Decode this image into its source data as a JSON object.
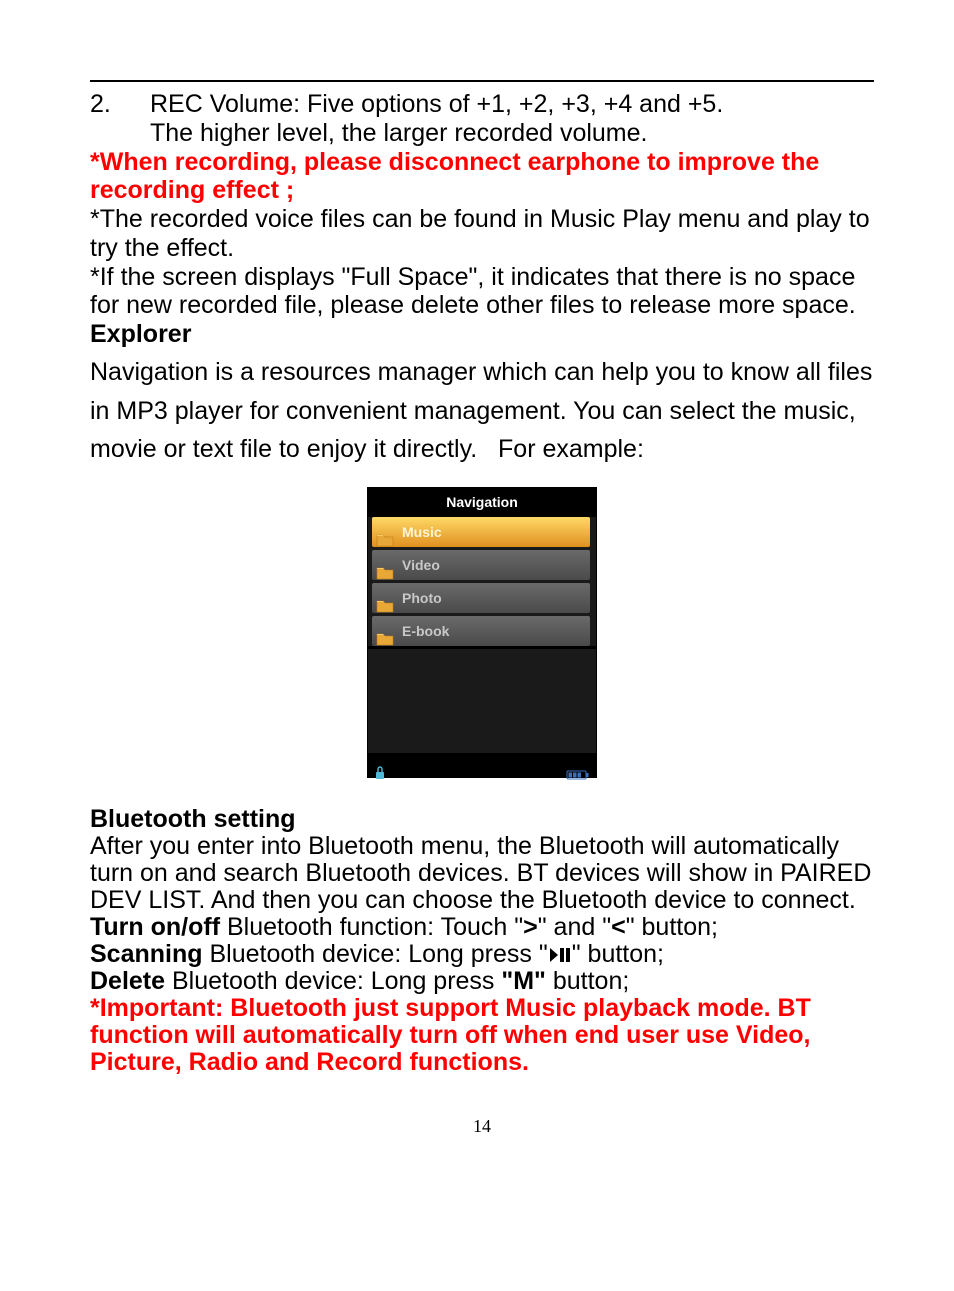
{
  "list": {
    "num": "2.",
    "line1": "REC Volume: Five options of +1, +2, +3, +4 and +5.",
    "line2": "The higher level, the larger recorded volume."
  },
  "warning1": "*When recording, please disconnect earphone to improve the recording effect ;",
  "note1": "*The recorded voice files can be found in Music Play menu and play to try the effect.",
  "note2": "*If the screen displays \"Full Space\", it indicates that there is no space for new recorded file, please delete other files to release more space.",
  "explorerHeading": "Explorer",
  "explorerPara": "Navigation is a resources manager which can help you to know all files in MP3 player for convenient management. You can select the music, movie or text file to enjoy it directly.   For example:",
  "nav": {
    "title": "Navigation",
    "items": [
      {
        "label": "Music",
        "selected": true
      },
      {
        "label": "Video",
        "selected": false
      },
      {
        "label": "Photo",
        "selected": false
      },
      {
        "label": "E-book",
        "selected": false
      }
    ]
  },
  "btHeading": "Bluetooth setting",
  "btIntro": "After you enter into Bluetooth menu, the Bluetooth will automatically turn on and search Bluetooth devices. BT devices will show in PAIRED DEV LIST. And then you can choose the Bluetooth device to connect.",
  "bt": {
    "turnLabel": "Turn on/off",
    "turnText1": " Bluetooth function: Touch \"",
    "gt": ">",
    "turnText2": "\" and \"",
    "lt": "<",
    "turnText3": "\" button;",
    "scanLabel": "Scanning",
    "scanText1": " Bluetooth device: Long press \"",
    "playPause": "▶❙❙",
    "scanText2": "\" button;",
    "deleteLabel": "Delete",
    "deleteText1": " Bluetooth device: Long press ",
    "mBtn": "\"M\"",
    "deleteText2": " button;"
  },
  "btWarning": "*Important: Bluetooth just support Music playback mode. BT function will automatically turn off when end user use Video, Picture, Radio and Record functions.",
  "pageNum": "14"
}
